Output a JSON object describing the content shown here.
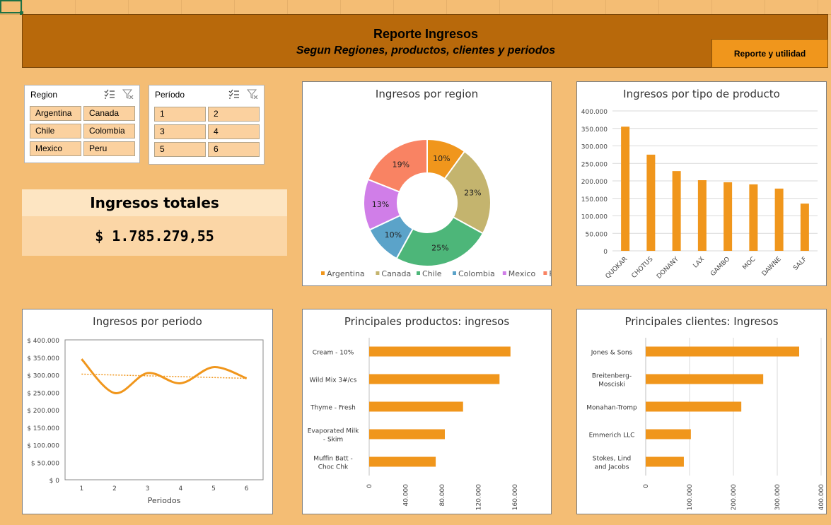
{
  "header": {
    "title": "Reporte Ingresos",
    "subtitle": "Segun Regiones, productos, clientes y periodos",
    "button_label": "Reporte y utilidad"
  },
  "slicer_region": {
    "title": "Region",
    "items": [
      "Argentina",
      "Canada",
      "Chile",
      "Colombia",
      "Mexico",
      "Peru"
    ]
  },
  "slicer_periodo": {
    "title": "Período",
    "items": [
      "1",
      "2",
      "3",
      "4",
      "5",
      "6"
    ]
  },
  "kpi": {
    "title": "Ingresos totales",
    "value": "$ 1.785.279,55"
  },
  "colors": {
    "accent": "#f0961c",
    "banner": "#b8690b",
    "background": "#f4bd74"
  },
  "chart_data": [
    {
      "type": "pie",
      "title": "Ingresos por region",
      "categories": [
        "Argentina",
        "Canada",
        "Chile",
        "Colombia",
        "Mexico",
        "Peru"
      ],
      "values": [
        10,
        23,
        25,
        10,
        13,
        19
      ],
      "labels": [
        "10%",
        "23%",
        "25%",
        "10%",
        "13%",
        "19%"
      ],
      "colors": [
        "#f0961c",
        "#c4b46e",
        "#4db679",
        "#5ba3c9",
        "#d07ee8",
        "#f98363"
      ],
      "legend": "bottom"
    },
    {
      "type": "bar",
      "title": "Ingresos por tipo de producto",
      "categories": [
        "QUOKAR",
        "CHOTUS",
        "DONANY",
        "LAX",
        "GAMBO",
        "MOC",
        "DAWNE",
        "SALF"
      ],
      "values": [
        355000,
        275000,
        228000,
        202000,
        196000,
        190000,
        178000,
        135000
      ],
      "ylim": [
        0,
        400000
      ],
      "yticks": [
        "0",
        "50.000",
        "100.000",
        "150.000",
        "200.000",
        "250.000",
        "300.000",
        "350.000",
        "400.000"
      ],
      "grid": true
    },
    {
      "type": "line",
      "title": "Ingresos por periodo",
      "x": [
        1,
        2,
        3,
        4,
        5,
        6
      ],
      "series": [
        {
          "values": [
            345000,
            248000,
            305000,
            276000,
            322000,
            290000
          ]
        }
      ],
      "trend": [
        302000,
        290000
      ],
      "xlabel": "Periodos",
      "ylim": [
        0,
        400000
      ],
      "yticks": [
        "$ 0",
        "$ 50.000",
        "$ 100.000",
        "$ 150.000",
        "$ 200.000",
        "$ 250.000",
        "$ 300.000",
        "$ 350.000",
        "$ 400.000"
      ],
      "xticks": [
        "1",
        "2",
        "3",
        "4",
        "5",
        "6"
      ]
    },
    {
      "type": "bar",
      "orientation": "horizontal",
      "title": "Principales productos: ingresos",
      "categories": [
        "Cream - 10%",
        "Wild Mix 3#/cs",
        "Thyme - Fresh",
        "Evaporated Milk - Skim",
        "Muffin Batt - Choc Chk"
      ],
      "values": [
        155000,
        143000,
        103000,
        83000,
        73000
      ],
      "xlim": [
        0,
        180000
      ],
      "xticks": [
        "0",
        "40.000",
        "80.000",
        "120.000",
        "160.000"
      ]
    },
    {
      "type": "bar",
      "orientation": "horizontal",
      "title": "Principales clientes: Ingresos",
      "categories": [
        "Jones & Sons",
        "Breitenberg-Mosciski",
        "Monahan-Tromp",
        "Emmerich LLC",
        "Stokes, Lind and Jacobs"
      ],
      "values": [
        350000,
        268000,
        218000,
        103000,
        87000
      ],
      "xlim": [
        0,
        400000
      ],
      "xticks": [
        "0",
        "100.000",
        "200.000",
        "300.000",
        "400.000"
      ],
      "grid": true
    }
  ]
}
